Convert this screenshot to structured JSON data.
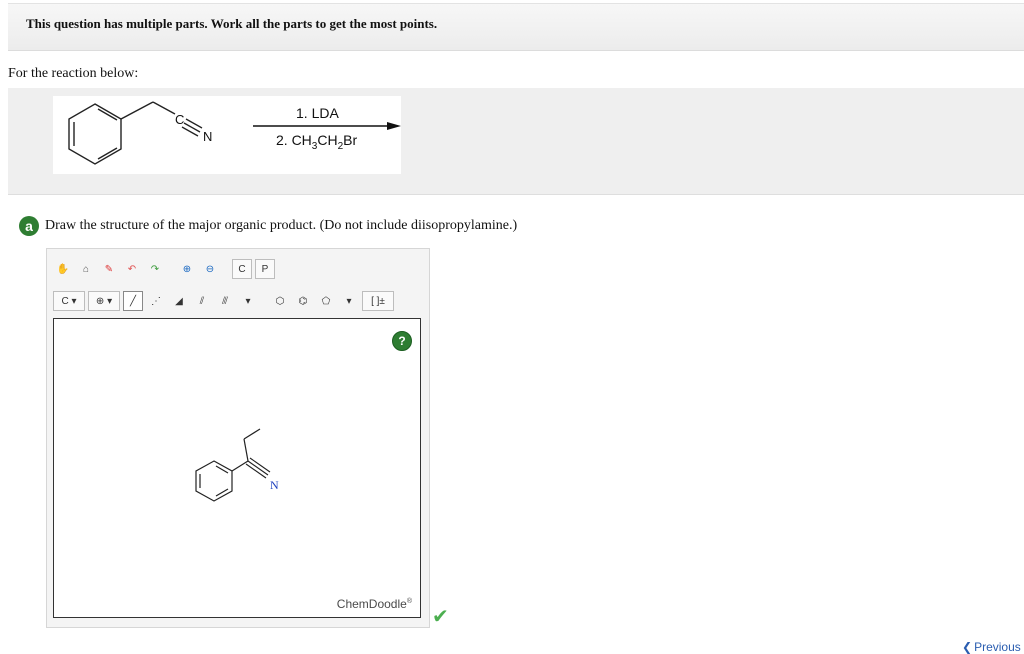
{
  "notice": {
    "text": "This question has multiple parts. Work all the parts to get the most points."
  },
  "intro": {
    "text": "For the reaction below:"
  },
  "reaction": {
    "reactant_label_c": "C",
    "reactant_label_n": "N",
    "reagent_1": "1. LDA",
    "reagent_2_prefix": "2. CH",
    "reagent_2_sub1": "3",
    "reagent_2_mid": "CH",
    "reagent_2_sub2": "2",
    "reagent_2_suffix": "Br"
  },
  "part_a": {
    "badge": "a",
    "question": "Draw the structure of the major organic product. (Do not include diisopropylamine.)"
  },
  "editor": {
    "toolbar1": [
      {
        "name": "hand-icon",
        "glyph": "✋"
      },
      {
        "name": "clear-icon",
        "glyph": "⌂"
      },
      {
        "name": "eraser-icon",
        "glyph": "✎"
      },
      {
        "name": "undo-icon",
        "glyph": "↶"
      },
      {
        "name": "redo-icon",
        "glyph": "↷"
      },
      {
        "name": "zoom-in-icon",
        "glyph": "⊕"
      },
      {
        "name": "zoom-out-icon",
        "glyph": "⊖"
      },
      {
        "name": "copy-icon",
        "glyph": "C"
      },
      {
        "name": "paste-icon",
        "glyph": "P"
      }
    ],
    "toolbar2": [
      {
        "name": "atom-c-dropdown",
        "glyph": "C ▾"
      },
      {
        "name": "charge-dropdown",
        "glyph": "⊕ ▾"
      },
      {
        "name": "single-bond-icon",
        "glyph": "╱"
      },
      {
        "name": "dashed-bond-icon",
        "glyph": "⋰"
      },
      {
        "name": "wedge-bond-icon",
        "glyph": "◢"
      },
      {
        "name": "double-bond-icon",
        "glyph": "⫽"
      },
      {
        "name": "triple-bond-icon",
        "glyph": "⫻"
      },
      {
        "name": "bond-dropdown-icon",
        "glyph": "▾"
      },
      {
        "name": "cyclohexane-icon",
        "glyph": "⬡"
      },
      {
        "name": "benzene-icon",
        "glyph": "⌬"
      },
      {
        "name": "cyclopentane-icon",
        "glyph": "⬠"
      },
      {
        "name": "ring-dropdown-icon",
        "glyph": "▾"
      },
      {
        "name": "bracket-icon",
        "glyph": "[ ]±"
      }
    ],
    "help": "?",
    "product_label_n": "N",
    "brand": "ChemDoodle",
    "brand_mark": "®"
  },
  "status": {
    "correct_icon": "check-icon",
    "accent": "#4caf50"
  },
  "nav": {
    "previous": "Previous"
  }
}
